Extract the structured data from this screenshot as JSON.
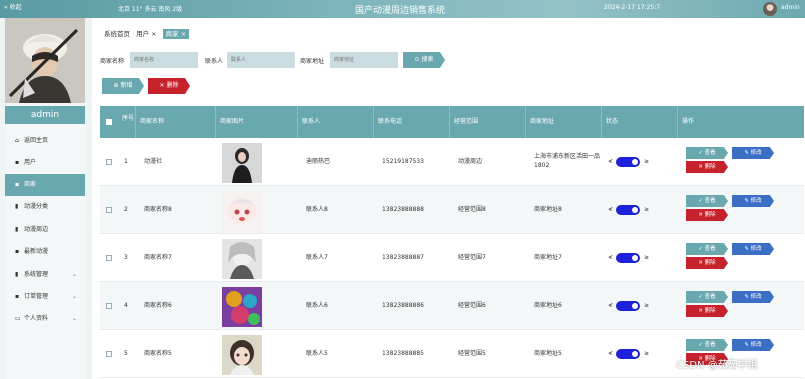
{
  "topbar": {
    "collapse_label": "« 收起",
    "weather": "北京  11°  多云  南风  2级",
    "title": "国产动漫周边销售系统",
    "datetime": "2024-2-17 17:25:7",
    "user": "admin"
  },
  "sidebar": {
    "admin_label": "admin",
    "items": [
      {
        "label": "返回主页",
        "icon": "home-icon"
      },
      {
        "label": "用户",
        "icon": "grid-icon"
      },
      {
        "label": "商家",
        "icon": "grid-icon"
      },
      {
        "label": "动漫分类",
        "icon": "bag-icon"
      },
      {
        "label": "动漫周边",
        "icon": "bag-icon"
      },
      {
        "label": "最新动漫",
        "icon": "grid-icon"
      },
      {
        "label": "系统管理",
        "icon": "database-icon"
      },
      {
        "label": "订单管理",
        "icon": "grid-icon"
      },
      {
        "label": "个人资料",
        "icon": "profile-icon"
      }
    ]
  },
  "breadcrumbs": {
    "home": "系统首页",
    "user": "用户 ×",
    "merchant": "商家 ×"
  },
  "search": {
    "name_label": "商家名称",
    "name_placeholder": "商家名称",
    "contact_label": "联系人",
    "contact_placeholder": "联系人",
    "addr_label": "商家地址",
    "addr_placeholder": "商家地址",
    "button": "⊙ 搜索"
  },
  "actions": {
    "add": "⊕ 新增",
    "delete": "✕ 删除"
  },
  "table": {
    "headers": [
      "序号",
      "商家名称",
      "商家图片",
      "联系人",
      "联系电话",
      "经营范围",
      "商家地址",
      "状态",
      "操作"
    ],
    "rows": [
      {
        "seq": "1",
        "name": "动漫社",
        "contact": "迪丽热巴",
        "phone": "15219187533",
        "scope": "动漫周边",
        "addr": "上海市浦东新区活田一品1802"
      },
      {
        "seq": "2",
        "name": "商家名称8",
        "contact": "联系人8",
        "phone": "13823888888",
        "scope": "经营范围8",
        "addr": "商家地址8"
      },
      {
        "seq": "3",
        "name": "商家名称7",
        "contact": "联系人7",
        "phone": "13823888887",
        "scope": "经营范围7",
        "addr": "商家地址7"
      },
      {
        "seq": "4",
        "name": "商家名称6",
        "contact": "联系人6",
        "phone": "13823888886",
        "scope": "经营范围6",
        "addr": "商家地址6"
      },
      {
        "seq": "5",
        "name": "商家名称5",
        "contact": "联系人5",
        "phone": "13823888885",
        "scope": "经营范围5",
        "addr": "商家地址5"
      }
    ],
    "toggle_left": "≮",
    "toggle_right": "≥",
    "view_label": "✓ 查看",
    "edit_label": "✎ 修改",
    "delete_label": "✕ 删除"
  },
  "watermark": "CSDN @茹茹学姐",
  "colors": {
    "accent": "#6aa8b0",
    "danger": "#c6222b",
    "edit": "#3b6fc4",
    "toggle": "#1d22d9"
  }
}
